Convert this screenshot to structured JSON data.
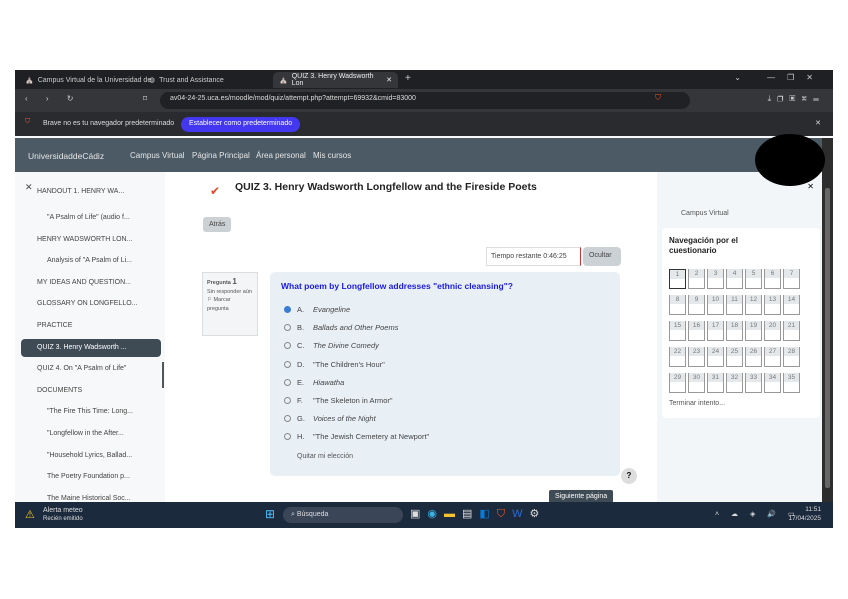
{
  "browser": {
    "tabs": [
      {
        "label": "Campus Virtual de la Universidad de"
      },
      {
        "label": "Trust and Assistance"
      },
      {
        "label": "QUIZ 3. Henry Wadsworth Lon"
      }
    ],
    "url": "av04-24-25.uca.es/moodle/mod/quiz/attempt.php?attempt=69932&cmid=83000",
    "infobar_text": "Brave no es tu navegador predeterminado",
    "infobar_button": "Establecer como predeterminado"
  },
  "site": {
    "logo": "UniversidaddeCádiz",
    "nav": [
      "Campus Virtual",
      "Página Principal",
      "Área personal",
      "Mis cursos"
    ]
  },
  "drawer": {
    "items": [
      {
        "label": "HANDOUT 1. HENRY WA...",
        "sub": false
      },
      {
        "label": "\"A Psalm of Life\" (audio f...",
        "sub": true
      },
      {
        "label": "HENRY WADSWORTH LON...",
        "sub": false
      },
      {
        "label": "Analysis of \"A Psalm of Li...",
        "sub": true
      },
      {
        "label": "MY IDEAS AND QUESTION...",
        "sub": false
      },
      {
        "label": "GLOSSARY ON LONGFELLO...",
        "sub": false
      },
      {
        "label": "PRACTICE",
        "sub": false
      },
      {
        "label": "QUIZ 3. Henry Wadsworth ...",
        "sub": false,
        "active": true
      },
      {
        "label": "QUIZ 4. On \"A Psalm of Life\"",
        "sub": false
      },
      {
        "label": "DOCUMENTS",
        "sub": false
      },
      {
        "label": "\"The Fire This Time: Long...",
        "sub": true
      },
      {
        "label": "\"Longfellow in the After...",
        "sub": true
      },
      {
        "label": "\"Household Lyrics, Ballad...",
        "sub": true
      },
      {
        "label": "The Poetry Foundation p...",
        "sub": true
      },
      {
        "label": "The Maine Historical Soc...",
        "sub": true
      }
    ]
  },
  "quiz": {
    "title": "QUIZ 3. Henry Wadsworth Longfellow and the Fireside Poets",
    "back": "Atrás",
    "timer": "Tiempo restante 0:46:25",
    "hide": "Ocultar",
    "qinfo": {
      "label": "Pregunta",
      "number": "1",
      "status": "Sin responder aún",
      "flag": "Marcar pregunta"
    },
    "question": "What poem by Longfellow addresses \"ethnic cleansing\"?",
    "options": [
      {
        "letter": "A.",
        "text": "Evangeline",
        "selected": true
      },
      {
        "letter": "B.",
        "text": "Ballads and Other Poems"
      },
      {
        "letter": "C.",
        "text": "The Divine Comedy"
      },
      {
        "letter": "D.",
        "text": "\"The Children's Hour\""
      },
      {
        "letter": "E.",
        "text": "Hiawatha"
      },
      {
        "letter": "F.",
        "text": "\"The Skeleton in Armor\""
      },
      {
        "letter": "G.",
        "text": "Voices of the Night"
      },
      {
        "letter": "H.",
        "text": "\"The Jewish Cemetery at Newport\""
      }
    ],
    "clear": "Quitar mi elección",
    "next": "Siguiente página",
    "help": "?"
  },
  "nav": {
    "breadcrumb": "Campus Virtual",
    "title": "Navegación por el cuestionario",
    "numbers": [
      "1",
      "2",
      "3",
      "4",
      "5",
      "6",
      "7",
      "8",
      "9",
      "10",
      "11",
      "12",
      "13",
      "14",
      "15",
      "16",
      "17",
      "18",
      "19",
      "20",
      "21",
      "22",
      "23",
      "24",
      "25",
      "26",
      "27",
      "28",
      "29",
      "30",
      "31",
      "32",
      "33",
      "34",
      "35"
    ],
    "current": "1",
    "finish": "Terminar intento..."
  },
  "taskbar": {
    "weather_title": "Alerta meteo",
    "weather_sub": "Recién emitido",
    "search": "Búsqueda",
    "time": "11:51",
    "date": "17/04/2025",
    "lang": "ESP"
  }
}
